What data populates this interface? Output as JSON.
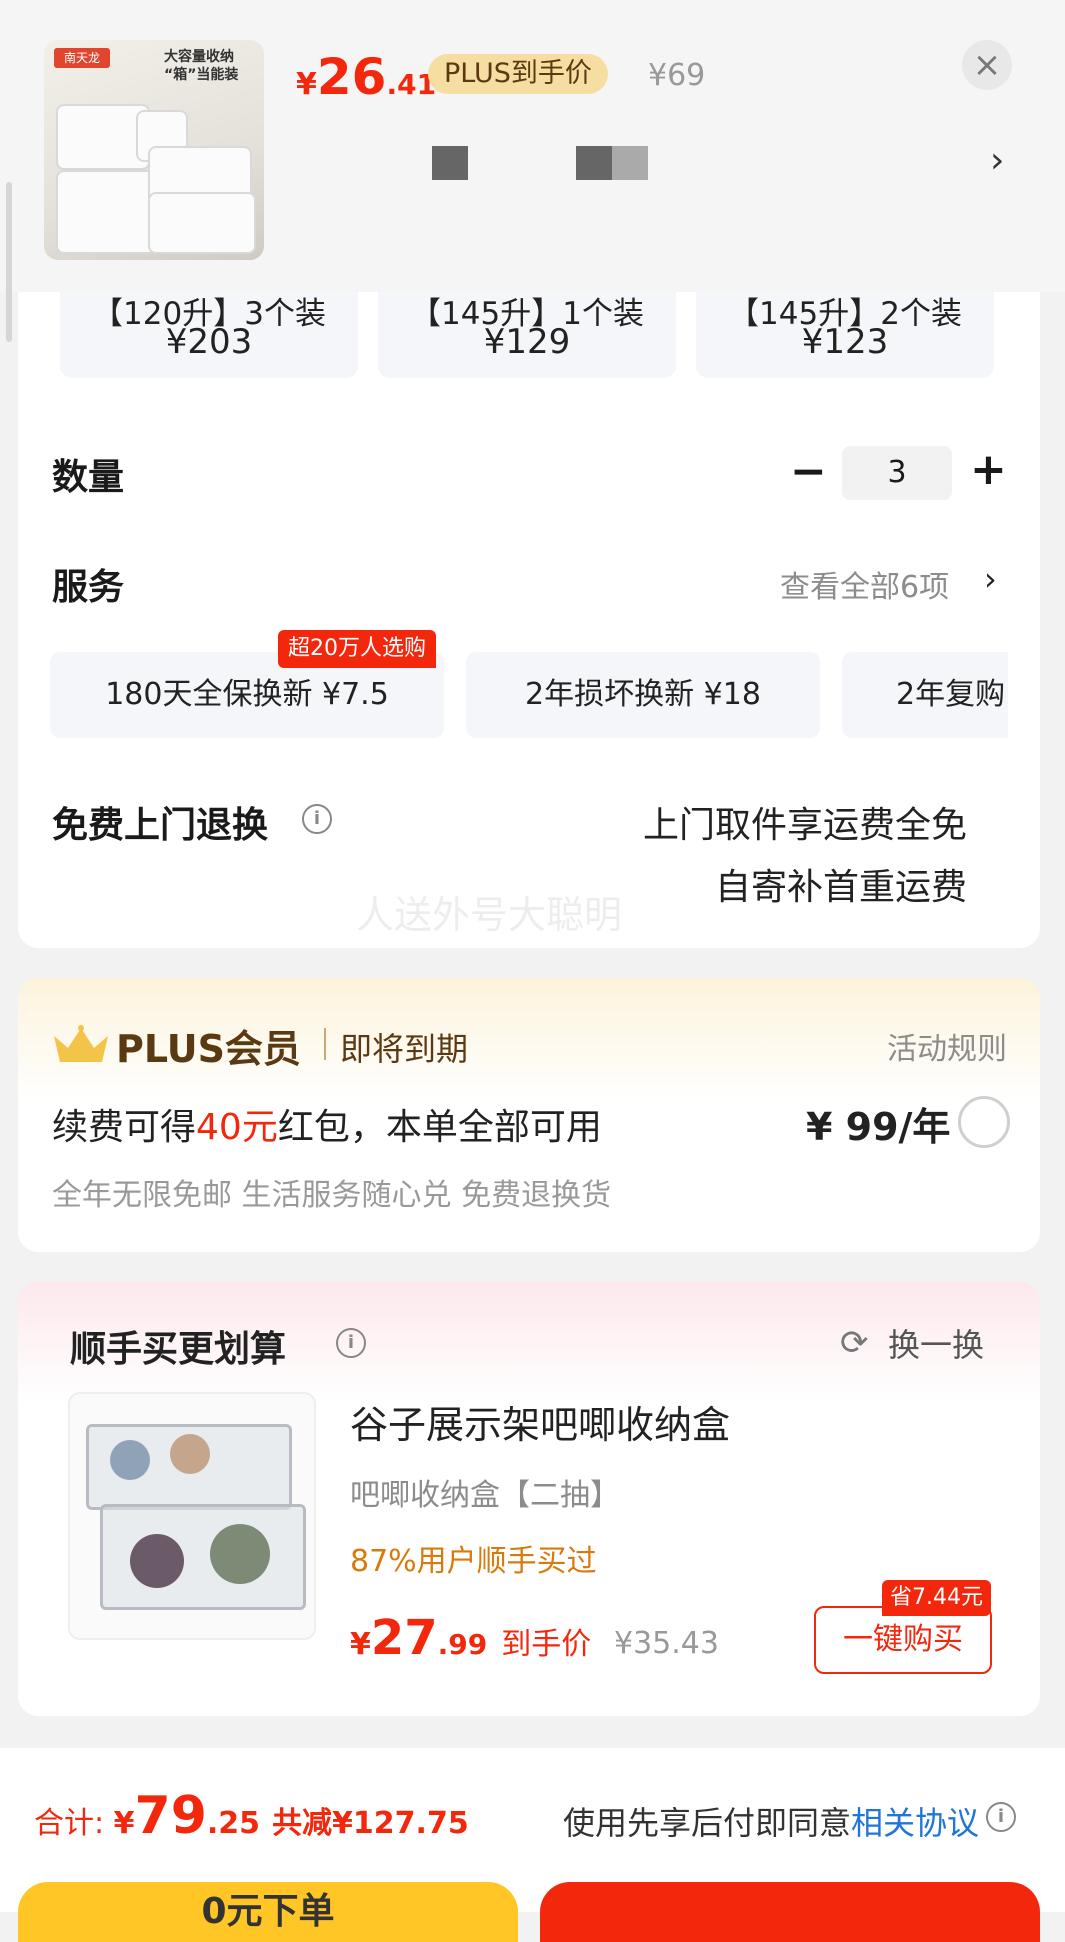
{
  "header": {
    "thumb_logo": "南天龙",
    "thumb_caption": "大容量收纳 “箱”当能装",
    "price_symbol": "¥",
    "price_int": "26",
    "price_dec": ".41",
    "plus_tag": "PLUS到手价",
    "original_price": "¥69",
    "close_icon": "×",
    "more_icon": "›"
  },
  "specs": [
    {
      "title": "【120升】3个装",
      "price": "¥203"
    },
    {
      "title": "【145升】1个装",
      "price": "¥129"
    },
    {
      "title": "【145升】2个装",
      "price": "¥123"
    }
  ],
  "quantity": {
    "label": "数量",
    "minus": "−",
    "value": "3",
    "plus": "+"
  },
  "services": {
    "label": "服务",
    "view_all": "查看全部6项",
    "arrow": "›",
    "hot_badge": "超20万人选购",
    "items": [
      "180天全保换新  ¥7.5",
      "2年损坏换新  ¥18",
      "2年复购"
    ]
  },
  "return": {
    "label": "免费上门退换",
    "info": "i",
    "line1": "上门取件享运费全免",
    "line2": "自寄补首重运费"
  },
  "watermark": "人送外号大聪明",
  "plus_member": {
    "title": "PLUS会员",
    "status": "即将到期",
    "rules": "活动规则",
    "line1_a": "续费可得",
    "line1_red": "40元",
    "line1_b": "红包，本单全部可用",
    "price": "¥ 99/年",
    "benefits": "全年无限免邮 生活服务随心兑 免费退换货"
  },
  "bundle": {
    "title": "顺手买更划算",
    "info": "i",
    "swap": "换一换",
    "product_name": "谷子展示架吧唧收纳盒",
    "product_spec": "吧唧收纳盒【二抽】",
    "bought_rate": "87%用户顺手买过",
    "price_symbol": "¥",
    "price_int": "27",
    "price_dec": ".99",
    "price_label": "到手价",
    "original_price": "¥35.43",
    "save_badge": "省7.44元",
    "buy_button": "一键购买"
  },
  "footer": {
    "total_label": "合计: ",
    "total_symbol": "¥",
    "total_int": "79",
    "total_dec": ".25",
    "total_saved": "共减¥127.75",
    "agreement_prefix": "使用先享后付即同意",
    "agreement_link": "相关协议",
    "info": "i",
    "left_button": "0元下单"
  },
  "colors": {
    "accent_red": "#f2270c",
    "plus_gold": "#f6dda1",
    "link_blue": "#1f76d8",
    "button_yellow": "#ffc626"
  }
}
